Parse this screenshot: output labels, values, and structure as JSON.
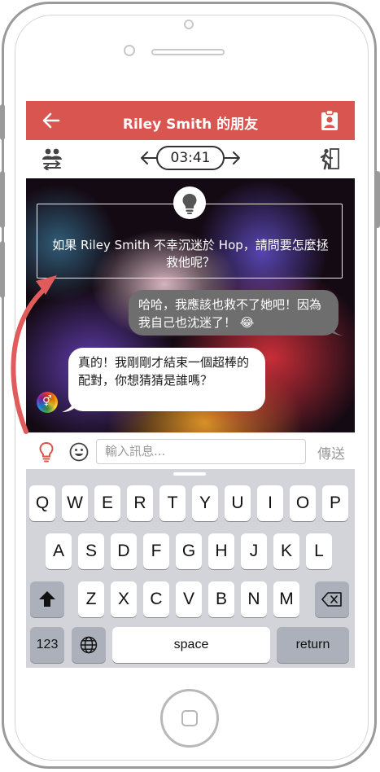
{
  "header": {
    "title": "Riley Smith 的朋友"
  },
  "toolbar": {
    "timer": "03:41"
  },
  "chat": {
    "tip_text": "如果 Riley Smith 不幸沉迷於 Hop，請問要怎麼拯救他呢？",
    "messages": [
      {
        "side": "right",
        "text": "哈哈，我應該也救不了她吧！因為我自己也沈迷了！ 😂"
      },
      {
        "side": "left",
        "text": "真的！我剛剛才結束一個超棒的配對，你想猜猜是誰嗎？"
      }
    ],
    "avatar_symbol": "⚥"
  },
  "input": {
    "placeholder": "輸入訊息...",
    "send_label": "傳送"
  },
  "keyboard": {
    "row1": [
      "Q",
      "W",
      "E",
      "R",
      "T",
      "Y",
      "U",
      "I",
      "O",
      "P"
    ],
    "row2": [
      "A",
      "S",
      "D",
      "F",
      "G",
      "H",
      "J",
      "K",
      "L"
    ],
    "row3": [
      "Z",
      "X",
      "C",
      "V",
      "B",
      "N",
      "M"
    ],
    "numbers_label": "123",
    "space_label": "space",
    "return_label": "return"
  },
  "colors": {
    "accent": "#d95550",
    "annotation_arrow": "#e05b5b"
  }
}
